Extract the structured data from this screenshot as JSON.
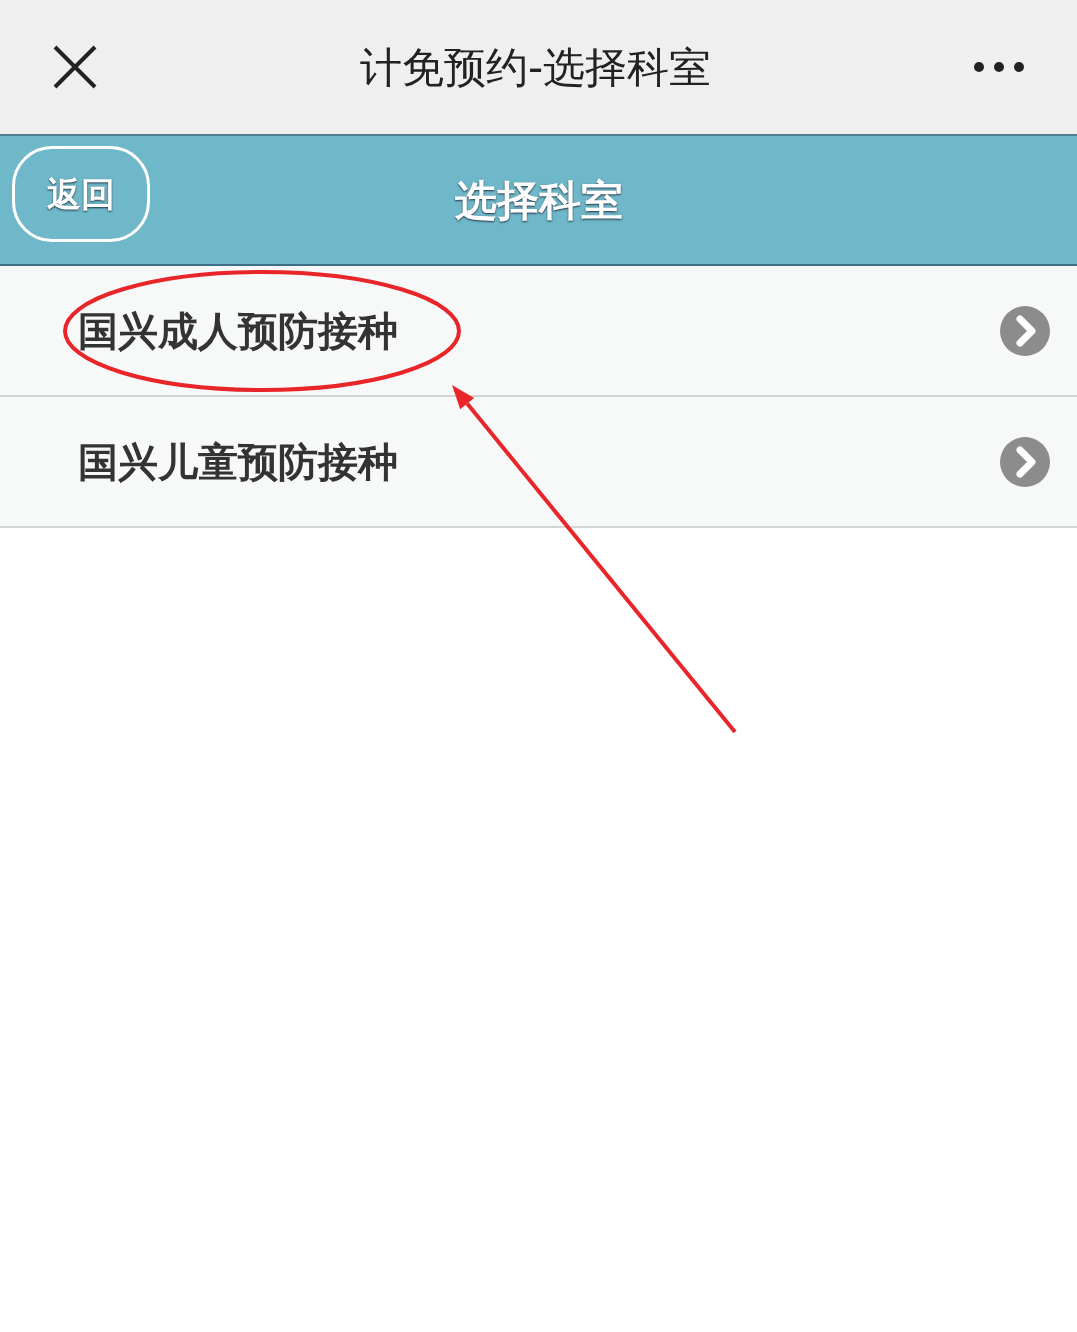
{
  "top_bar": {
    "title": "计免预约-选择科室"
  },
  "header": {
    "back_button": "返回",
    "title": "选择科室"
  },
  "list": [
    {
      "label": "国兴成人预防接种"
    },
    {
      "label": "国兴儿童预防接种"
    }
  ],
  "annotations": [
    {
      "kind": "ellipse"
    },
    {
      "kind": "arrow"
    }
  ]
}
